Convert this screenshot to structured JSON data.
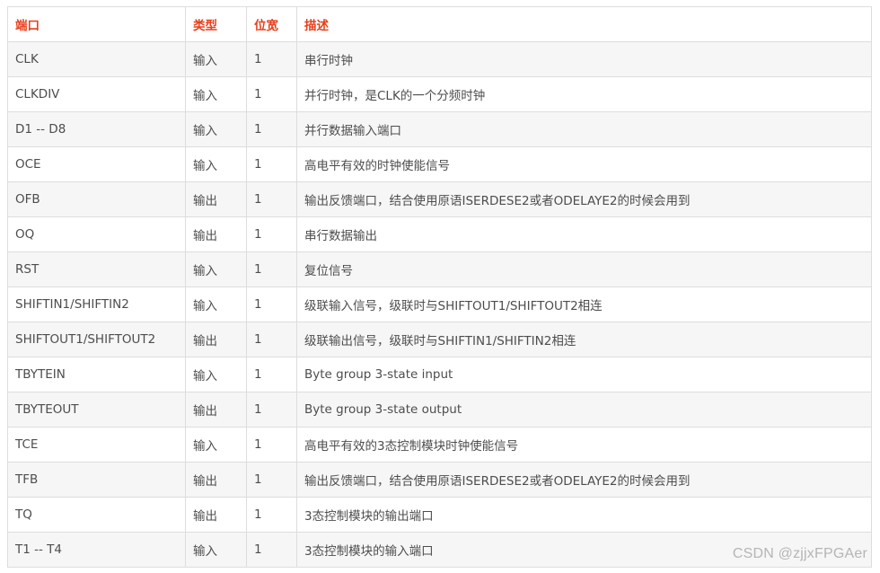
{
  "table": {
    "headers": [
      "端口",
      "类型",
      "位宽",
      "描述"
    ],
    "rows": [
      [
        "CLK",
        "输入",
        "1",
        "串行时钟"
      ],
      [
        "CLKDIV",
        "输入",
        "1",
        "并行时钟，是CLK的一个分频时钟"
      ],
      [
        "D1 -- D8",
        "输入",
        "1",
        "并行数据输入端口"
      ],
      [
        "OCE",
        "输入",
        "1",
        "高电平有效的时钟使能信号"
      ],
      [
        "OFB",
        "输出",
        "1",
        "输出反馈端口，结合使用原语ISERDESE2或者ODELAYE2的时候会用到"
      ],
      [
        "OQ",
        "输出",
        "1",
        "串行数据输出"
      ],
      [
        "RST",
        "输入",
        "1",
        "复位信号"
      ],
      [
        "SHIFTIN1/SHIFTIN2",
        "输入",
        "1",
        "级联输入信号，级联时与SHIFTOUT1/SHIFTOUT2相连"
      ],
      [
        "SHIFTOUT1/SHIFTOUT2",
        "输出",
        "1",
        "级联输出信号，级联时与SHIFTIN1/SHIFTIN2相连"
      ],
      [
        "TBYTEIN",
        "输入",
        "1",
        "Byte group 3-state input"
      ],
      [
        "TBYTEOUT",
        "输出",
        "1",
        "Byte group 3-state output"
      ],
      [
        "TCE",
        "输入",
        "1",
        "高电平有效的3态控制模块时钟使能信号"
      ],
      [
        "TFB",
        "输出",
        "1",
        "输出反馈端口，结合使用原语ISERDESE2或者ODELAYE2的时候会用到"
      ],
      [
        "TQ",
        "输出",
        "1",
        "3态控制模块的输出端口"
      ],
      [
        "T1 -- T4",
        "输入",
        "1",
        "3态控制模块的输入端口"
      ]
    ]
  },
  "watermark": "CSDN @zjjxFPGAer",
  "colors": {
    "header_text": "#e83e1a",
    "body_text": "#4d4d4d",
    "border": "#dddddd",
    "stripe": "#f6f6f6"
  }
}
